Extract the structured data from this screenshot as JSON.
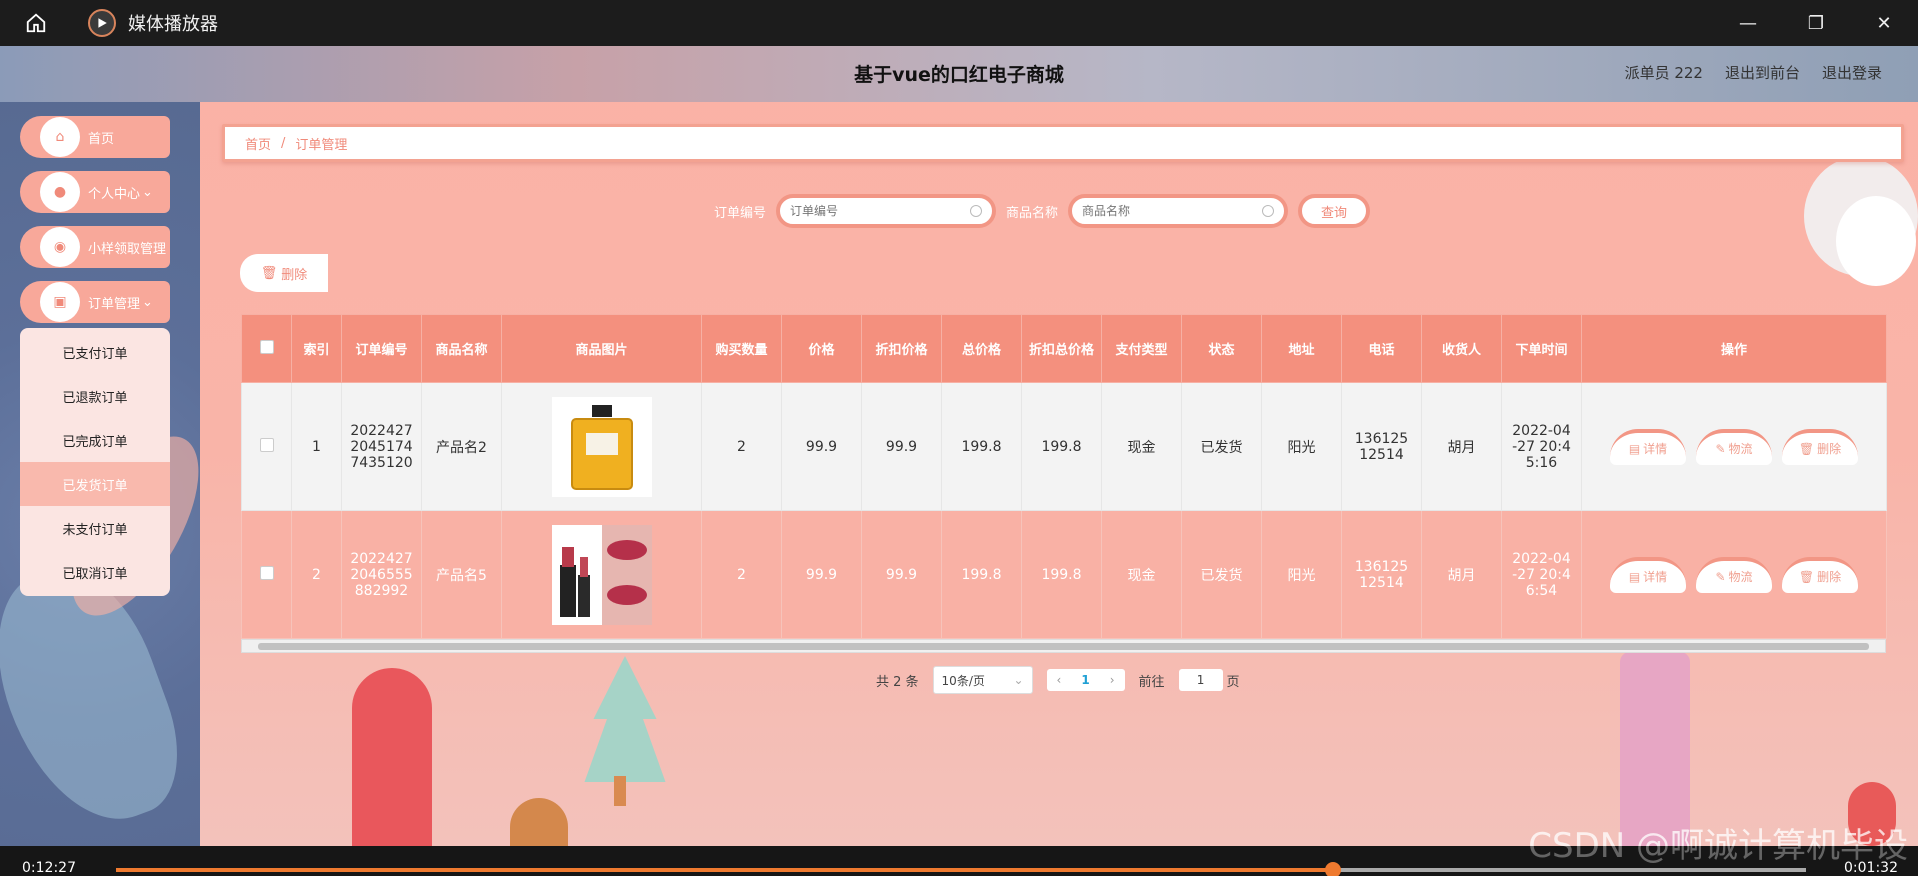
{
  "player": {
    "title": "媒体播放器",
    "time_elapsed": "0:12:27",
    "time_remaining": "0:01:32",
    "progress": 0.72,
    "watermark": "CSDN @啊诚计算机毕设"
  },
  "header": {
    "title": "基于vue的口红电子商城",
    "user": "派单员 222",
    "exit_front": "退出到前台",
    "logout": "退出登录"
  },
  "sidebar": {
    "items": [
      {
        "label": "首页",
        "icon": "home-icon"
      },
      {
        "label": "个人中心",
        "icon": "user-icon"
      },
      {
        "label": "小样领取管理",
        "icon": "location-icon"
      },
      {
        "label": "订单管理",
        "icon": "clipboard-icon"
      }
    ],
    "submenu": [
      "已支付订单",
      "已退款订单",
      "已完成订单",
      "已发货订单",
      "未支付订单",
      "已取消订单"
    ],
    "active_sub": "已发货订单"
  },
  "breadcrumb": {
    "home": "首页",
    "sep": "/",
    "current": "订单管理"
  },
  "search": {
    "order_label": "订单编号",
    "order_placeholder": "订单编号",
    "product_label": "商品名称",
    "product_placeholder": "商品名称",
    "query": "查询"
  },
  "actions": {
    "delete": "删除"
  },
  "table": {
    "headers": [
      "索引",
      "订单编号",
      "商品名称",
      "商品图片",
      "购买数量",
      "价格",
      "折扣价格",
      "总价格",
      "折扣总价格",
      "支付类型",
      "状态",
      "地址",
      "电话",
      "收货人",
      "下单时间",
      "操作"
    ],
    "rows": [
      {
        "index": "1",
        "order_no": "20224272045174 7435120",
        "product": "产品名2",
        "image": "perfume-bottle",
        "qty": "2",
        "price": "99.9",
        "discount_price": "99.9",
        "total": "199.8",
        "discount_total": "199.8",
        "pay_type": "现金",
        "status": "已发货",
        "address": "阳光",
        "phone": "13612512514",
        "receiver": "胡月",
        "time": "2022-04-27 20:45:16"
      },
      {
        "index": "2",
        "order_no": "20224272046555 882992",
        "product": "产品名5",
        "image": "lipstick",
        "qty": "2",
        "price": "99.9",
        "discount_price": "99.9",
        "total": "199.8",
        "discount_total": "199.8",
        "pay_type": "现金",
        "status": "已发货",
        "address": "阳光",
        "phone": "13612512514",
        "receiver": "胡月",
        "time": "2022-04-27 20:46:54"
      }
    ],
    "op_labels": {
      "detail": "详情",
      "logistics": "物流",
      "delete": "删除"
    }
  },
  "pagination": {
    "total": "共 2 条",
    "page_size": "10条/页",
    "current_page": "1",
    "goto_label": "前往",
    "goto_value": "1",
    "page_suffix": "页"
  }
}
